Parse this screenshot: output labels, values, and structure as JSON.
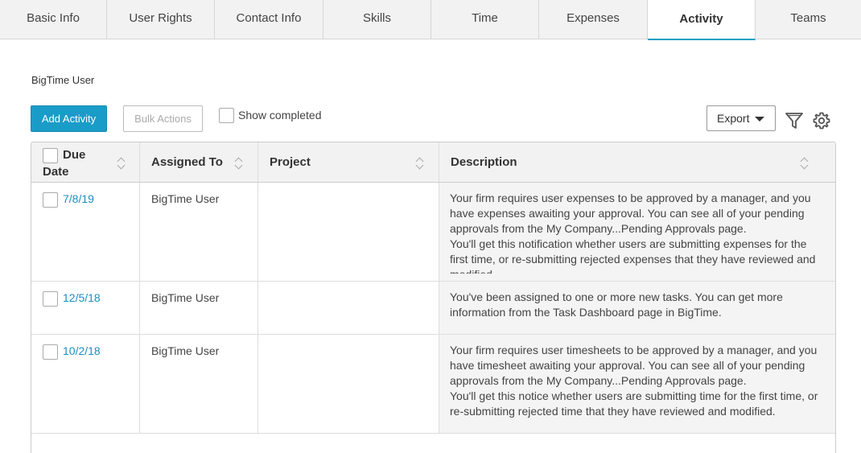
{
  "tabs": [
    {
      "label": "Basic Info",
      "active": false
    },
    {
      "label": "User Rights",
      "active": false
    },
    {
      "label": "Contact Info",
      "active": false
    },
    {
      "label": "Skills",
      "active": false
    },
    {
      "label": "Time",
      "active": false
    },
    {
      "label": "Expenses",
      "active": false
    },
    {
      "label": "Activity",
      "active": true
    },
    {
      "label": "Teams",
      "active": false
    }
  ],
  "user_label": "BigTime User",
  "toolbar": {
    "add_activity_label": "Add Activity",
    "bulk_actions_label": "Bulk Actions",
    "show_completed_label": "Show completed",
    "export_label": "Export"
  },
  "table": {
    "headers": {
      "due_line1": "Due",
      "due_line2": "Date",
      "assigned_to": "Assigned To",
      "project": "Project",
      "description": "Description"
    },
    "rows": [
      {
        "due": "7/8/19",
        "assigned_to": "BigTime User",
        "project": "",
        "description_p1": "Your firm requires user expenses to be approved by a manager, and you have expenses awaiting your approval. You can see all of your pending approvals from the My Company...Pending Approvals page.",
        "description_p2": "You'll get this notification whether users are submitting expenses for the first time, or re-submitting rejected expenses that they have reviewed and modified."
      },
      {
        "due": "12/5/18",
        "assigned_to": "BigTime User",
        "project": "",
        "description_p1": "You've been assigned to one or more new tasks. You can get more information from the Task Dashboard page in BigTime.",
        "description_p2": ""
      },
      {
        "due": "10/2/18",
        "assigned_to": "BigTime User",
        "project": "",
        "description_p1": "Your firm requires user timesheets to be approved by a manager, and you have timesheet awaiting your approval. You can see all of your pending approvals from the My Company...Pending Approvals page.",
        "description_p2": "You'll get this notice whether users are submitting time for the first time, or re-submitting rejected time that they have reviewed and modified."
      }
    ]
  },
  "colors": {
    "accent": "#1a9cc8",
    "link": "#1a8fc0",
    "active_tab_underline": "#1a9fc4"
  },
  "icons": [
    "filter-icon",
    "gear-icon",
    "caret-down-icon",
    "sort-icon"
  ]
}
